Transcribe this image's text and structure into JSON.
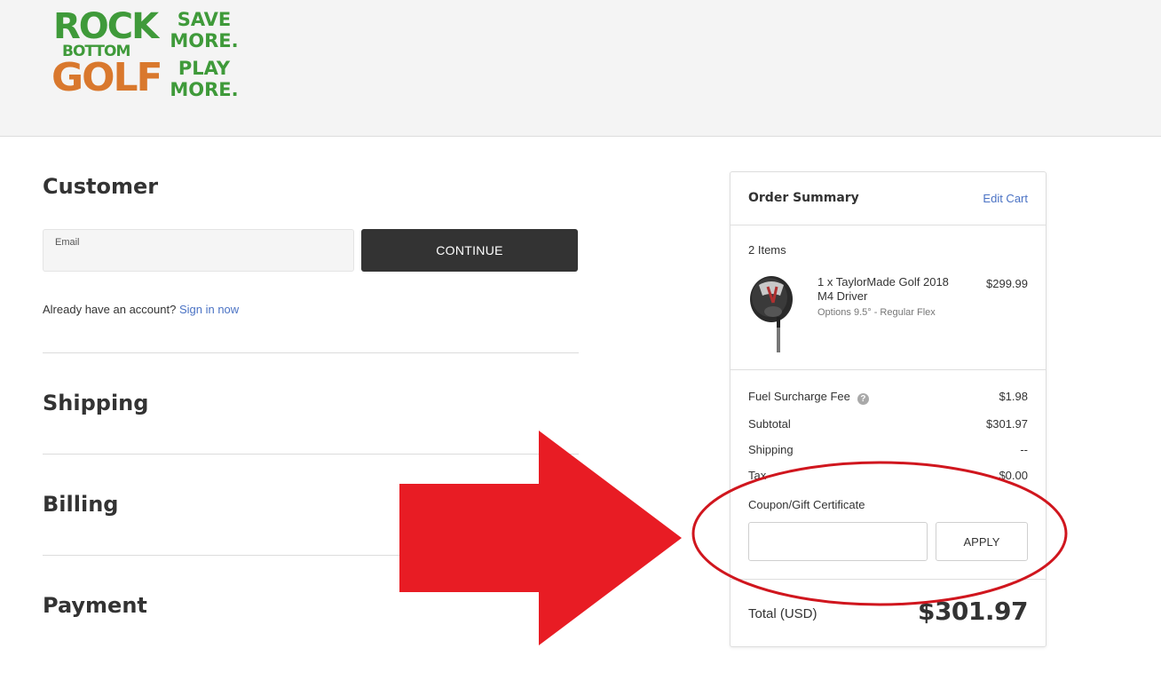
{
  "brand": {
    "logo_line1": "ROCK",
    "logo_line2": "BOTTOM",
    "logo_line3": "GOLF",
    "tagline1": "SAVE MORE.",
    "tagline2": "PLAY MORE.",
    "green": "#3f9a3a",
    "orange": "#d9782d"
  },
  "checkout": {
    "customer_title": "Customer",
    "email_label": "Email",
    "email_value": "",
    "continue_label": "CONTINUE",
    "already_account": "Already have an account?",
    "sign_in_link": "Sign in now",
    "shipping_title": "Shipping",
    "billing_title": "Billing",
    "payment_title": "Payment"
  },
  "summary": {
    "title": "Order Summary",
    "edit_cart": "Edit Cart",
    "items_count": "2 Items",
    "product": {
      "name": "1 x TaylorMade Golf 2018 M4 Driver",
      "options": "Options 9.5° - Regular Flex",
      "price": "$299.99",
      "image": "golf-driver-image"
    },
    "rows": [
      {
        "label": "Fuel Surcharge Fee",
        "value": "$1.98",
        "help": "?"
      },
      {
        "label": "Subtotal",
        "value": "$301.97"
      },
      {
        "label": "Shipping",
        "value": "--"
      },
      {
        "label": "Tax",
        "value": "$0.00"
      }
    ],
    "coupon_label": "Coupon/Gift Certificate",
    "coupon_value": "",
    "apply_label": "APPLY",
    "total_label": "Total (USD)",
    "total_value": "$301.97"
  },
  "annotation": {
    "arrow_color": "#e81c24",
    "ellipse_color": "#d0161e"
  }
}
